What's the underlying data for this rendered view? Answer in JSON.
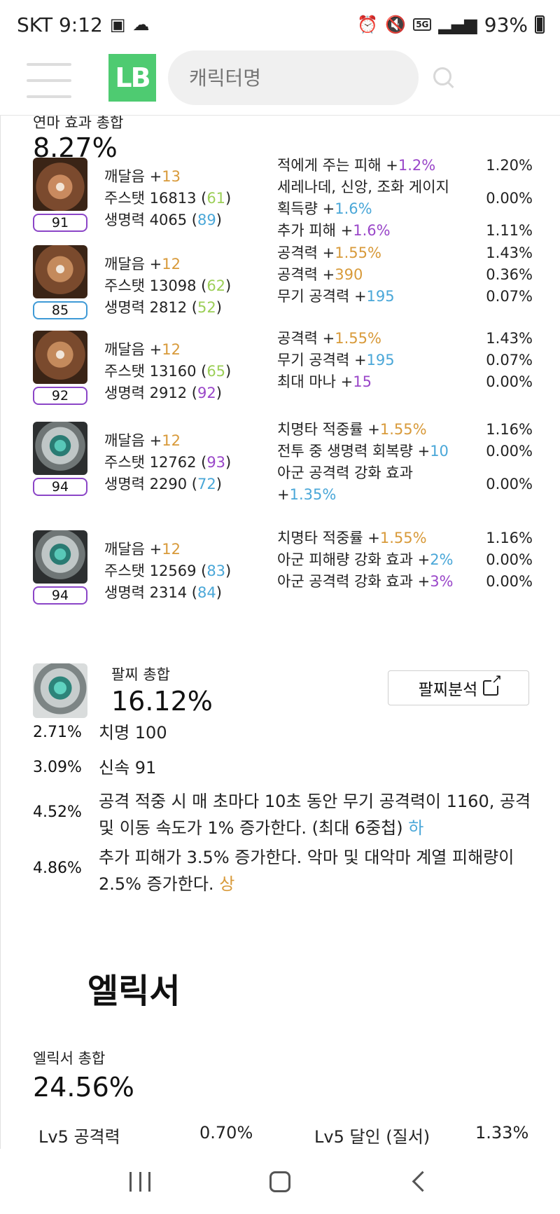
{
  "status_bar": {
    "carrier_time": "SKT 9:12",
    "network": "5G",
    "battery": "93%"
  },
  "header": {
    "logo_text": "LB",
    "search_placeholder": "캐릭터명"
  },
  "accessory_section": {
    "label": "연마 효과 총합",
    "total": "8.27%",
    "items": [
      {
        "icon": "necklace",
        "badge": "91",
        "badge_color": "#8b45c7",
        "awakening_label": "깨달음 +",
        "awakening_value": "13",
        "main_stat_label": "주스탯 16813 (",
        "main_stat_q": "61",
        "main_stat_q_color": "#9ccf57",
        "hp_label": "생명력 4065 (",
        "hp_q": "89",
        "hp_q_color": "#4aa7d8",
        "effects": [
          {
            "text": "적에게 주는 피해 +",
            "value": "1.2%",
            "value_color": "#9a47c9",
            "pct": "1.20%"
          },
          {
            "text": "세레나데, 신앙, 조화 게이지 획득량 +",
            "value": "1.6%",
            "value_color": "#4aa7d8",
            "pct": "0.00%"
          },
          {
            "text": "추가 피해 +",
            "value": "1.6%",
            "value_color": "#9a47c9",
            "pct": "1.11%"
          }
        ]
      },
      {
        "icon": "earring",
        "badge": "85",
        "badge_color": "#3f9ad6",
        "awakening_label": "깨달음 +",
        "awakening_value": "12",
        "main_stat_label": "주스탯 13098 (",
        "main_stat_q": "62",
        "main_stat_q_color": "#9ccf57",
        "hp_label": "생명력 2812 (",
        "hp_q": "52",
        "hp_q_color": "#9ccf57",
        "effects": [
          {
            "text": "공격력 +",
            "value": "1.55%",
            "value_color": "#d89a3a",
            "pct": "1.43%"
          },
          {
            "text": "공격력 +",
            "value": "390",
            "value_color": "#d89a3a",
            "pct": "0.36%"
          },
          {
            "text": "무기 공격력 +",
            "value": "195",
            "value_color": "#4aa7d8",
            "pct": "0.07%"
          }
        ]
      },
      {
        "icon": "earring",
        "badge": "92",
        "badge_color": "#8b45c7",
        "awakening_label": "깨달음 +",
        "awakening_value": "12",
        "main_stat_label": "주스탯 13160 (",
        "main_stat_q": "65",
        "main_stat_q_color": "#9ccf57",
        "hp_label": "생명력 2912 (",
        "hp_q": "92",
        "hp_q_color": "#9a47c9",
        "effects": [
          {
            "text": "공격력 +",
            "value": "1.55%",
            "value_color": "#d89a3a",
            "pct": "1.43%"
          },
          {
            "text": "무기 공격력 +",
            "value": "195",
            "value_color": "#4aa7d8",
            "pct": "0.07%"
          },
          {
            "text": "최대 마나 +",
            "value": "15",
            "value_color": "#9a47c9",
            "pct": "0.00%"
          }
        ]
      },
      {
        "icon": "ring",
        "badge": "94",
        "badge_color": "#8b45c7",
        "awakening_label": "깨달음 +",
        "awakening_value": "12",
        "main_stat_label": "주스탯 12762 (",
        "main_stat_q": "93",
        "main_stat_q_color": "#9a47c9",
        "hp_label": "생명력 2290 (",
        "hp_q": "72",
        "hp_q_color": "#4aa7d8",
        "effects": [
          {
            "text": "치명타 적중률 +",
            "value": "1.55%",
            "value_color": "#d89a3a",
            "pct": "1.16%"
          },
          {
            "text": "전투 중 생명력 회복량 +",
            "value": "10",
            "value_color": "#4aa7d8",
            "pct": "0.00%"
          },
          {
            "text": "아군 공격력 강화 효과 +",
            "value": "1.35%",
            "value_color": "#4aa7d8",
            "pct": "0.00%"
          }
        ]
      },
      {
        "icon": "ring",
        "badge": "94",
        "badge_color": "#8b45c7",
        "awakening_label": "깨달음 +",
        "awakening_value": "12",
        "main_stat_label": "주스탯 12569 (",
        "main_stat_q": "83",
        "main_stat_q_color": "#4aa7d8",
        "hp_label": "생명력 2314 (",
        "hp_q": "84",
        "hp_q_color": "#4aa7d8",
        "effects": [
          {
            "text": "치명타 적중률 +",
            "value": "1.55%",
            "value_color": "#d89a3a",
            "pct": "1.16%"
          },
          {
            "text": "아군 피해량 강화 효과 +",
            "value": "2%",
            "value_color": "#4aa7d8",
            "pct": "0.00%"
          },
          {
            "text": "아군 공격력 강화 효과 +",
            "value": "3%",
            "value_color": "#9a47c9",
            "pct": "0.00%"
          }
        ]
      }
    ]
  },
  "bracelet": {
    "label": "팔찌 총합",
    "total": "16.12%",
    "analysis_button": "팔찌분석",
    "options": [
      {
        "pct": "2.71%",
        "text": "치명 100",
        "grade": "",
        "grade_color": ""
      },
      {
        "pct": "3.09%",
        "text": "신속 91",
        "grade": "",
        "grade_color": ""
      },
      {
        "pct": "4.52%",
        "text": "공격 적중 시 매 초마다 10초 동안 무기 공격력이 1160, 공격 및 이동 속도가 1% 증가한다. (최대 6중첩) ",
        "grade": "하",
        "grade_color": "#4aa7d8"
      },
      {
        "pct": "4.86%",
        "text": "추가 피해가 3.5% 증가한다. 악마 및 대악마 계열 피해량이 2.5% 증가한다. ",
        "grade": "상",
        "grade_color": "#d89a3a"
      }
    ]
  },
  "elixir": {
    "title": "엘릭서",
    "label": "엘릭서 총합",
    "total": "24.56%",
    "rows": [
      {
        "name": "Lv5 공격력",
        "pct": "0.70%"
      },
      {
        "name": "Lv5 달인 (질서)",
        "pct": "1.33%"
      }
    ]
  }
}
